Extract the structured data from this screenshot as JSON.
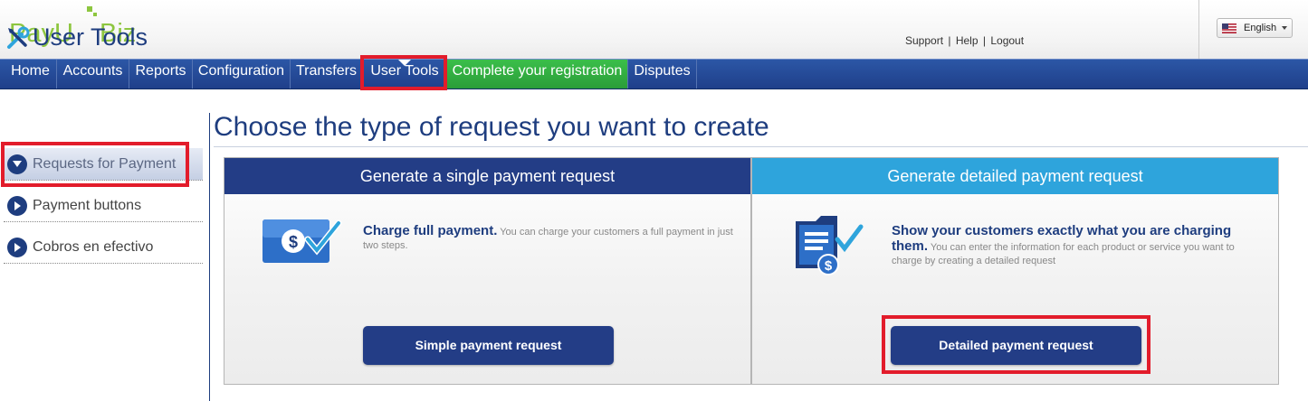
{
  "brand": {
    "logo_text_left": "PayU",
    "logo_text_right": "Biz",
    "colors": {
      "navy": "#233d86",
      "green": "#8dc63f",
      "cyan": "#2ea4dc",
      "highlight_red": "#e21c2b"
    }
  },
  "header": {
    "links": [
      "Support",
      "Help",
      "Logout"
    ],
    "separator": "|",
    "language": {
      "selected": "English",
      "flag_icon": "us-flag-icon"
    }
  },
  "nav": {
    "items": [
      {
        "label": "Home"
      },
      {
        "label": "Accounts"
      },
      {
        "label": "Reports"
      },
      {
        "label": "Configuration"
      },
      {
        "label": "Transfers"
      },
      {
        "label": "User Tools"
      },
      {
        "label": "Complete your registration"
      },
      {
        "label": "Disputes"
      }
    ],
    "active": "User Tools"
  },
  "sidebar": {
    "title": "User Tools",
    "title_icon": "tools-icon",
    "items": [
      {
        "label": "Requests for Payment",
        "selected": true
      },
      {
        "label": "Payment buttons",
        "selected": false
      },
      {
        "label": "Cobros en efectivo",
        "selected": false
      }
    ]
  },
  "main": {
    "title": "Choose the type of request you want to create",
    "panels": [
      {
        "header": "Generate a single payment request",
        "icon": "dollar-check-card-icon",
        "headline": "Charge full payment.",
        "body": " You can charge your customers a full payment in just two steps.",
        "button": "Simple payment request"
      },
      {
        "header": "Generate detailed payment request",
        "icon": "invoice-dollar-check-icon",
        "headline": "Show your customers exactly what you are charging them.",
        "body": " You can enter the information for each product or service you want to charge by creating a detailed request",
        "button": "Detailed payment request"
      }
    ]
  }
}
